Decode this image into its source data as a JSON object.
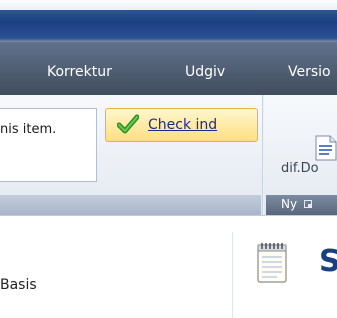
{
  "ribbon": {
    "tabs": [
      {
        "label": "Korrektur"
      },
      {
        "label": "Udgiv"
      },
      {
        "label": "Versio"
      }
    ],
    "notice_text": "nis item.",
    "checkin_label": "Check ind",
    "document_label": "dif.Do",
    "group_label": "Ny"
  },
  "content": {
    "left_text": "Basis",
    "heading": "S"
  },
  "colors": {
    "accent_blue": "#1f2d88",
    "highlight_yellow": "#ffdf80",
    "checkmark_green": "#3aa832"
  },
  "icons": {
    "checkin": "checkmark-icon",
    "document": "document-icon",
    "launcher": "dialog-launcher-icon",
    "notepad": "notepad-icon"
  }
}
